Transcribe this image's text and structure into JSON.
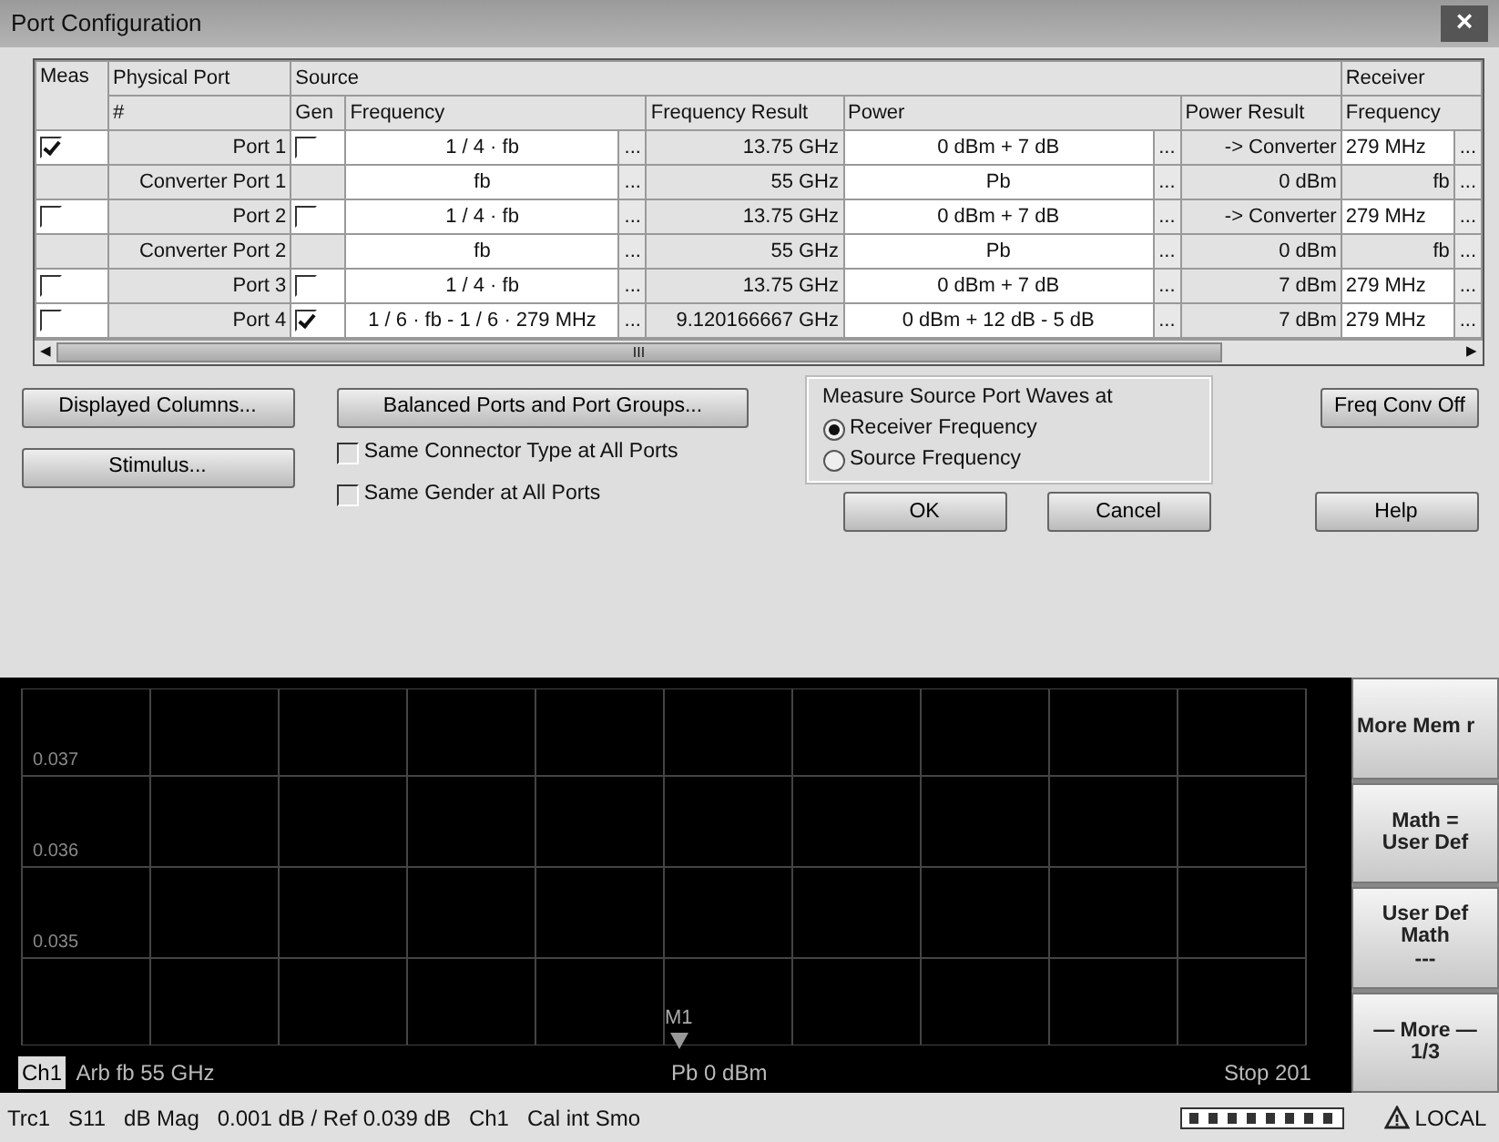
{
  "dialog": {
    "title": "Port Configuration",
    "close": "×",
    "table": {
      "group_headers": [
        "Meas",
        "Physical Port",
        "Source",
        "Receiver"
      ],
      "columns": [
        "#",
        "Gen",
        "Frequency",
        "Frequency Result",
        "Power",
        "Power Result",
        "Frequency"
      ],
      "rows": [
        {
          "kind": "port",
          "meas": true,
          "port": "Port 1",
          "gen": false,
          "frequency": "1 / 4 · fb",
          "frequency_result": "13.75 GHz",
          "power": "0 dBm + 7 dB",
          "power_result": "-> Converter",
          "receiver_frequency": "279 MHz"
        },
        {
          "kind": "converter",
          "port": "Converter Port 1",
          "frequency": "fb",
          "frequency_result": "55 GHz",
          "power": "Pb",
          "power_result": "0 dBm",
          "receiver_frequency": "fb"
        },
        {
          "kind": "port",
          "meas": false,
          "port": "Port 2",
          "gen": false,
          "frequency": "1 / 4 · fb",
          "frequency_result": "13.75 GHz",
          "power": "0 dBm + 7 dB",
          "power_result": "-> Converter",
          "receiver_frequency": "279 MHz"
        },
        {
          "kind": "converter",
          "port": "Converter Port 2",
          "frequency": "fb",
          "frequency_result": "55 GHz",
          "power": "Pb",
          "power_result": "0 dBm",
          "receiver_frequency": "fb"
        },
        {
          "kind": "port",
          "meas": false,
          "port": "Port 3",
          "gen": false,
          "frequency": "1 / 4 · fb",
          "frequency_result": "13.75 GHz",
          "power": "0 dBm + 7 dB",
          "power_result": "7 dBm",
          "receiver_frequency": "279 MHz"
        },
        {
          "kind": "port",
          "meas": false,
          "port": "Port 4",
          "gen": true,
          "frequency": "1 / 6 · fb - 1 / 6 · 279 MHz",
          "frequency_result": "9.120166667 GHz",
          "power": "0 dBm + 12 dB  - 5 dB",
          "power_result": "7 dBm",
          "receiver_frequency": "279 MHz"
        }
      ],
      "ellipsis": "...",
      "scroll_grip": "III",
      "scroll_left": "◂",
      "scroll_right": "▸"
    },
    "buttons_left": [
      "Displayed Columns...",
      "Stimulus..."
    ],
    "balanced_button": "Balanced Ports and Port Groups...",
    "checkboxes": [
      {
        "label": "Same Connector Type at All Ports",
        "checked": false
      },
      {
        "label": "Same Gender at All Ports",
        "checked": false
      }
    ],
    "measure_group": {
      "title": "Measure Source Port Waves at",
      "options": [
        {
          "label": "Receiver Frequency",
          "selected": true
        },
        {
          "label": "Source Frequency",
          "selected": false
        }
      ]
    },
    "freq_conv_button": "Freq Conv Off",
    "bottom_buttons": [
      "OK",
      "Cancel",
      "Help"
    ]
  },
  "display": {
    "y_labels": [
      "0.037",
      "0.036",
      "0.035"
    ],
    "marker": "M1",
    "channel": "Ch1",
    "start": "Arb  fb  55 GHz",
    "power": "Pb  0 dBm",
    "stop": "Stop  201"
  },
  "softkeys": [
    {
      "lines": [
        "More Mem r"
      ]
    },
    {
      "lines": [
        "Math =",
        "User Def"
      ]
    },
    {
      "lines": [
        "User Def",
        "Math",
        "---"
      ]
    },
    {
      "lines": [
        "— More —",
        "1/3"
      ]
    }
  ],
  "status_bar": {
    "text": "Trc1   S11   dB Mag   0.001 dB / Ref 0.039 dB   Ch1   Cal int Smo",
    "local": "LOCAL"
  }
}
